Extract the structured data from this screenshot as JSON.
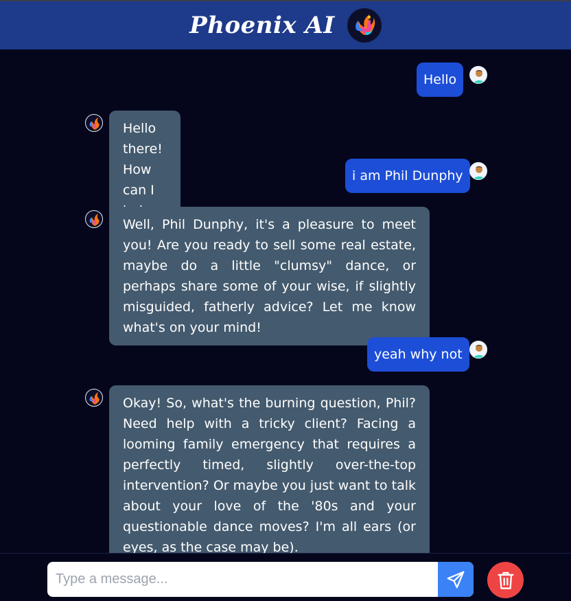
{
  "header": {
    "title": "Phoenix AI",
    "logo_icon": "phoenix-logo-icon",
    "bg_color": "#1e3a8a"
  },
  "messages": [
    {
      "role": "user",
      "text": "Hello"
    },
    {
      "role": "bot",
      "text": "Hello there! How can I help you today?"
    },
    {
      "role": "user",
      "text": "i am Phil Dunphy"
    },
    {
      "role": "bot",
      "text": "Well, Phil Dunphy, it's a pleasure to meet you! Are you ready to sell some real estate, maybe do a little \"clumsy\" dance, or perhaps share some of your wise, if slightly misguided, fatherly advice? Let me know what's on your mind!"
    },
    {
      "role": "user",
      "text": "yeah why not"
    },
    {
      "role": "bot",
      "text": "Okay! So, what's the burning question, Phil? Need help with a tricky client? Facing a looming family emergency that requires a perfectly timed, slightly over-the-top intervention? Or maybe you just want to talk about your love of the '80s and your questionable dance moves? I'm all ears (or eyes, as the case may be)."
    }
  ],
  "composer": {
    "placeholder": "Type a message...",
    "value": "",
    "send_icon": "send-icon",
    "clear_icon": "trash-icon"
  },
  "colors": {
    "background": "#05061c",
    "user_bubble": "#1d4ed8",
    "bot_bubble": "#445a6e",
    "send_button": "#3b82f6",
    "clear_button": "#ef4444"
  }
}
